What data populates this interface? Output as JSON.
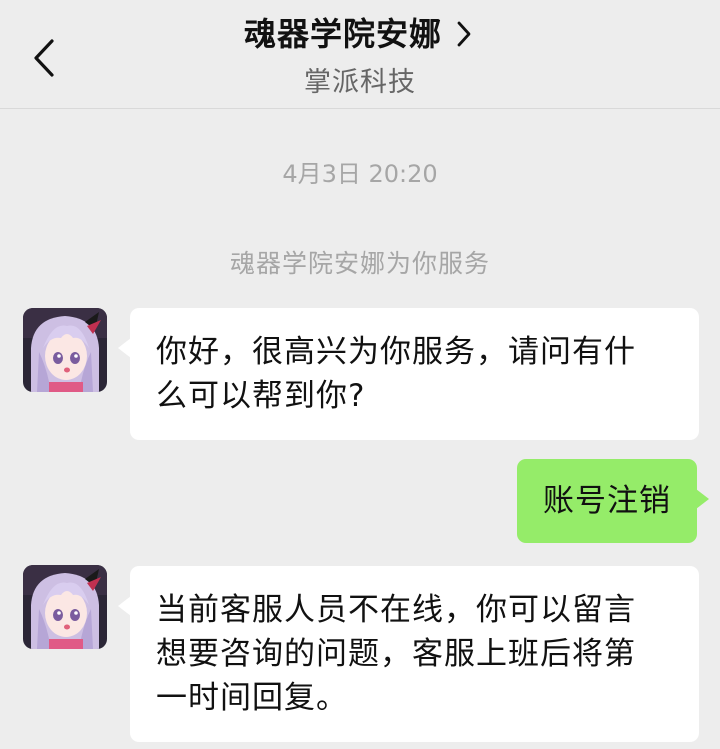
{
  "header": {
    "title": "魂器学院安娜",
    "subtitle": "掌派科技",
    "back_icon": "chevron-left-icon",
    "title_arrow_icon": "chevron-right-icon"
  },
  "chat": {
    "timestamp": "4月3日 20:20",
    "system_message": "魂器学院安娜为你服务",
    "messages": [
      {
        "from": "agent",
        "text": "你好，很高兴为你服务，请问有什 么可以帮到你?"
      },
      {
        "from": "me",
        "text": "账号注销"
      },
      {
        "from": "agent",
        "text": "当前客服人员不在线，你可以留言 想要咨询的问题，客服上班后将第 一时间回复。"
      }
    ]
  },
  "colors": {
    "background": "#ededed",
    "incoming_bubble": "#ffffff",
    "outgoing_bubble": "#95ec69",
    "meta_text": "#a6a6a6"
  }
}
